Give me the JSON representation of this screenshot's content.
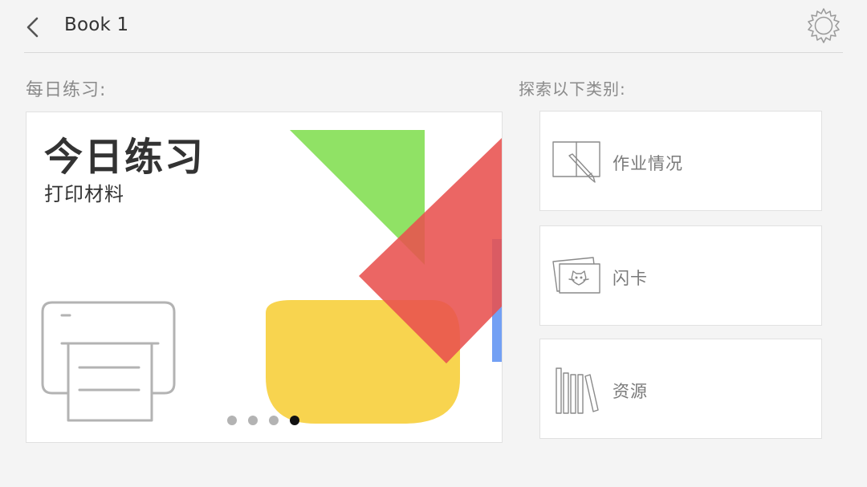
{
  "header": {
    "title": "Book 1",
    "back_icon": "chevron-left-icon",
    "settings_icon": "gear-icon"
  },
  "daily": {
    "section_label": "每日练习:",
    "card": {
      "title": "今日练习",
      "subtitle": "打印材料",
      "icon": "printer-icon",
      "carousel_total": 4,
      "carousel_active_index": 3
    }
  },
  "explore": {
    "section_label": "探索以下类别:",
    "categories": [
      {
        "label": "作业情况",
        "icon": "notebook-pencil-icon"
      },
      {
        "label": "闪卡",
        "icon": "flashcards-cat-icon"
      },
      {
        "label": "资源",
        "icon": "books-icon"
      }
    ]
  },
  "colors": {
    "background": "#f4f4f4",
    "card": "#ffffff",
    "green": "#7cdd4a",
    "red": "#e8514f",
    "yellow": "#f7cf3c",
    "blue": "#5b8ff2",
    "dot_active": "#111111",
    "dot_inactive": "#b3b3b3"
  }
}
